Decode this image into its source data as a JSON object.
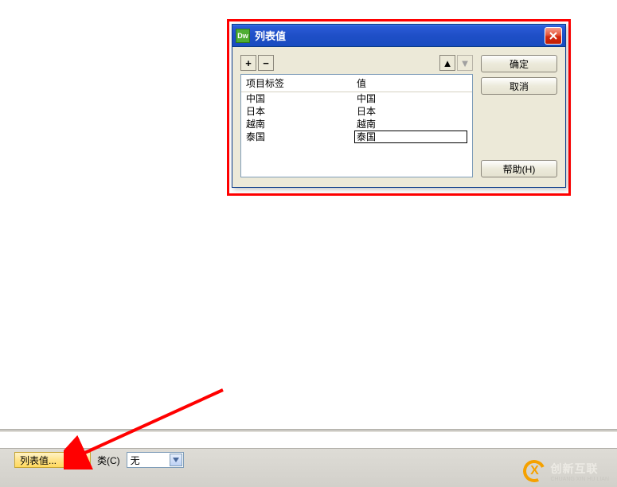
{
  "dialog": {
    "app_badge": "Dw",
    "title": "列表值",
    "toolbar": {
      "add": "+",
      "remove": "−",
      "up": "▲",
      "down": "▼"
    },
    "columns": {
      "label": "项目标签",
      "value": "值"
    },
    "rows": [
      {
        "label": "中国",
        "value": "中国"
      },
      {
        "label": "日本",
        "value": "日本"
      },
      {
        "label": "越南",
        "value": "越南"
      },
      {
        "label": "泰国",
        "value": "泰国"
      }
    ],
    "buttons": {
      "ok": "确定",
      "cancel": "取消",
      "help": "帮助(H)"
    }
  },
  "prop_bar": {
    "list_values_btn": "列表值...",
    "class_label": "类(C)",
    "class_value": "无"
  },
  "brand": {
    "name": "创新互联",
    "sub": "CHUANG XIN HU LIAN"
  }
}
